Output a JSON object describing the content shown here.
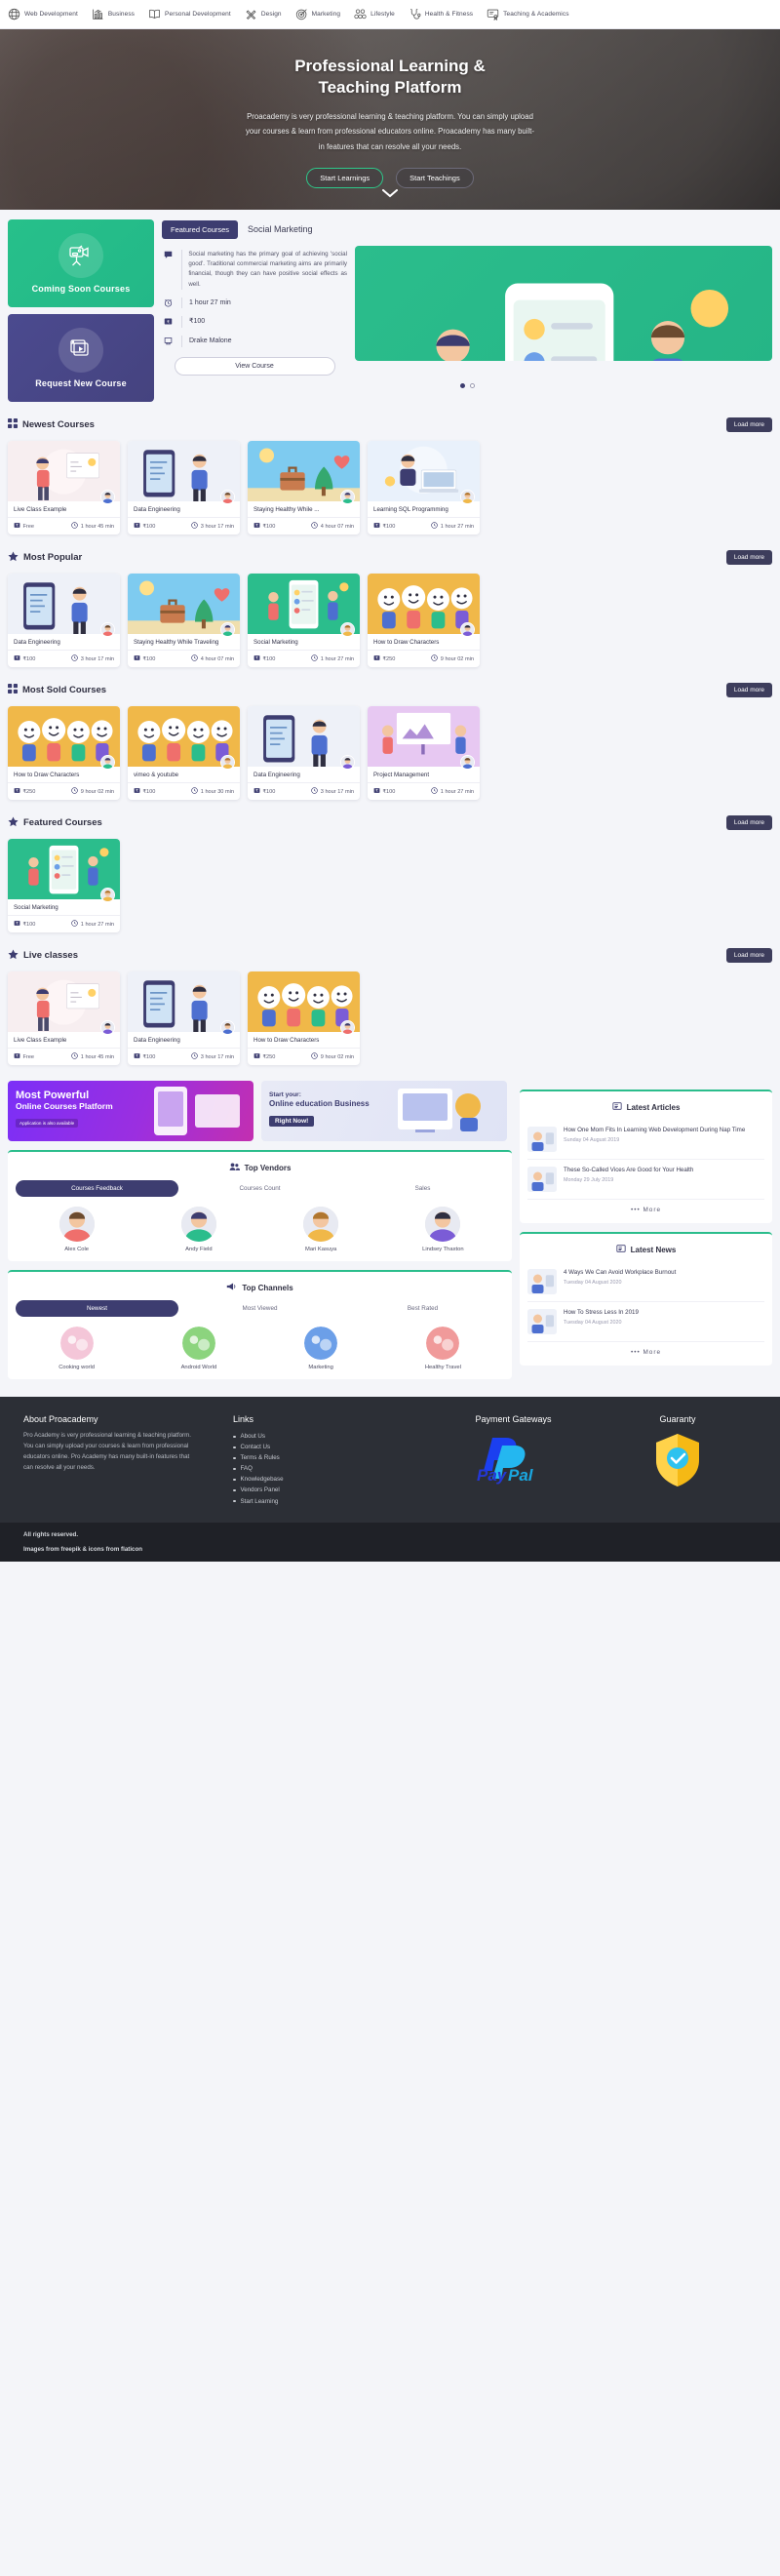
{
  "topbar": {
    "categories": [
      {
        "icon": "globe-icon",
        "label": "Web Development"
      },
      {
        "icon": "bar-chart-icon",
        "label": "Business"
      },
      {
        "icon": "book-icon",
        "label": "Personal Development"
      },
      {
        "icon": "pencil-ruler-icon",
        "label": "Design"
      },
      {
        "icon": "target-icon",
        "label": "Marketing"
      },
      {
        "icon": "group-icon",
        "label": "Lifestyle"
      },
      {
        "icon": "stethoscope-icon",
        "label": "Health & Fitness"
      },
      {
        "icon": "certificate-icon",
        "label": "Teaching & Academics"
      }
    ]
  },
  "hero": {
    "title_line1": "Professional Learning &",
    "title_line2": "Teaching Platform",
    "paragraph": "Proacademy is very professional learning & teaching platform. You can simply upload your courses & learn from professional educators online. Proacademy has many built-in features that can resolve all your needs.",
    "primary_button": "Start Learnings",
    "secondary_button": "Start Teachings",
    "scroll_icon": "chevron-down-icon"
  },
  "promos": [
    {
      "title": "Coming Soon Courses",
      "icon": "video-camera-icon",
      "color": "#27c08a"
    },
    {
      "title": "Request New Course",
      "icon": "play-stack-icon",
      "color": "#4b4a8f"
    }
  ],
  "featured": {
    "tab_active": "Featured Courses",
    "tab_title": "Social Marketing",
    "description": "Social marketing has the primary goal of achieving 'social good'. Traditional commercial marketing aims are primarily financial, though they can have positive social effects as well.",
    "duration": "1 hour 27 min",
    "price": "₹100",
    "instructor": "Drake Malone",
    "view_button": "View Course",
    "slide_dots": 2,
    "active_dot": 0
  },
  "sections": [
    {
      "icon": "grid-icon",
      "title": "Newest Courses",
      "load_more": "Load more",
      "courses": [
        {
          "name": "Live Class Example",
          "price": "Free",
          "duration": "1 hour 45 min",
          "thumb": "woman-board",
          "color": "#f6e3e6"
        },
        {
          "name": "Data Engineering",
          "price": "₹100",
          "duration": "3 hour 17 min",
          "thumb": "dev-screen",
          "color": "#e9edf6"
        },
        {
          "name": "Staying Healthy While ...",
          "price": "₹100",
          "duration": "4 hour 07 min",
          "thumb": "travel-health",
          "color": "#7ecbf0"
        },
        {
          "name": "Learning SQL Programming",
          "price": "₹100",
          "duration": "1 hour 27 min",
          "thumb": "laptop-woman",
          "color": "#e7effb"
        }
      ]
    },
    {
      "icon": "star-icon",
      "title": "Most Popular",
      "load_more": "Load more",
      "courses": [
        {
          "name": "Data Engineering",
          "price": "₹100",
          "duration": "3 hour 17 min",
          "thumb": "dev-screen",
          "color": "#eef1f8"
        },
        {
          "name": "Staying Healthy While Traveling",
          "price": "₹100",
          "duration": "4 hour 07 min",
          "thumb": "travel-health",
          "color": "#7ecbf0"
        },
        {
          "name": "Social Marketing",
          "price": "₹100",
          "duration": "1 hour 27 min",
          "thumb": "social-chat",
          "color": "#2bbd8c"
        },
        {
          "name": "How to Draw Characters",
          "price": "₹250",
          "duration": "9 hour 02 min",
          "thumb": "faces",
          "color": "#f0b849"
        }
      ]
    },
    {
      "icon": "grid-icon",
      "title": "Most Sold Courses",
      "load_more": "Load more",
      "courses": [
        {
          "name": "How to Draw Characters",
          "price": "₹250",
          "duration": "9 hour 02 min",
          "thumb": "faces",
          "color": "#f0b849"
        },
        {
          "name": "vimeo & youtube",
          "price": "₹100",
          "duration": "1 hour 30 min",
          "thumb": "faces",
          "color": "#f0b849"
        },
        {
          "name": "Data Engineering",
          "price": "₹100",
          "duration": "3 hour 17 min",
          "thumb": "dev-screen",
          "color": "#eef1f8"
        },
        {
          "name": "Project Management",
          "price": "₹100",
          "duration": "1 hour 27 min",
          "thumb": "presentation",
          "color": "#e7c8f2"
        }
      ]
    },
    {
      "icon": "star-icon",
      "title": "Featured Courses",
      "load_more": "Load more",
      "courses": [
        {
          "name": "Social Marketing",
          "price": "₹100",
          "duration": "1 hour 27 min",
          "thumb": "social-chat",
          "color": "#2bbd8c"
        }
      ]
    },
    {
      "icon": "star-icon",
      "title": "Live classes",
      "load_more": "Load more",
      "courses": [
        {
          "name": "Live Class Example",
          "price": "Free",
          "duration": "1 hour 45 min",
          "thumb": "woman-board",
          "color": "#f6e3e6"
        },
        {
          "name": "Data Engineering",
          "price": "₹100",
          "duration": "3 hour 17 min",
          "thumb": "dev-screen",
          "color": "#eef1f8"
        },
        {
          "name": "How to Draw Characters",
          "price": "₹250",
          "duration": "9 hour 02 min",
          "thumb": "faces",
          "color": "#f0b849"
        }
      ]
    }
  ],
  "banners": [
    {
      "line1": "Most Powerful",
      "line2": "Online Courses Platform",
      "line3": "Application is also available"
    },
    {
      "line1": "Start your:",
      "line2": "Online education Business",
      "cta": "Right Now!"
    }
  ],
  "top_vendors": {
    "title": "Top Vendors",
    "icon": "people-icon",
    "tabs": [
      "Courses Feedback",
      "Courses Count",
      "Sales"
    ],
    "active_tab": 0,
    "vendors": [
      {
        "name": "Alex Cole"
      },
      {
        "name": "Andy Field"
      },
      {
        "name": "Mari Kasuya"
      },
      {
        "name": "Lindsey Thaxton"
      }
    ]
  },
  "top_channels": {
    "title": "Top Channels",
    "icon": "megaphone-icon",
    "tabs": [
      "Newest",
      "Most Viewed",
      "Best Rated"
    ],
    "active_tab": 0,
    "channels": [
      {
        "name": "Cooking world"
      },
      {
        "name": "Android World"
      },
      {
        "name": "Marketing"
      },
      {
        "name": "Healthy Travel"
      }
    ]
  },
  "latest_articles": {
    "title": "Latest Articles",
    "icon": "news-icon",
    "items": [
      {
        "title": "How One Mom Fits In Learning Web Development During Nap Time",
        "date": "Sunday 04 August 2019"
      },
      {
        "title": "These So-Called Vices Are Good for Your Health",
        "date": "Monday 29 July 2019"
      }
    ],
    "more": "••• More"
  },
  "latest_news": {
    "title": "Latest News",
    "icon": "news-icon",
    "items": [
      {
        "title": "4 Ways We Can Avoid Workplace Burnout",
        "date": "Tuesday 04 August 2020"
      },
      {
        "title": "How To Stress Less In 2019",
        "date": "Tuesday 04 August 2020"
      }
    ],
    "more": "••• More"
  },
  "footer": {
    "about_title": "About Proacademy",
    "about_text": "Pro Academy is very professional learning & teaching platform. You can simply upload your courses & learn from professional educators online. Pro Academy has many built-in features that can resolve all your needs.",
    "links_title": "Links",
    "links": [
      "About Us",
      "Contact Us",
      "Terms & Rules",
      "FAQ",
      "Knowledgebase",
      "Vendors Panel",
      "Start Learning"
    ],
    "payment_title": "Payment Gateways",
    "payment_logo": "PayPal",
    "guaranty_title": "Guaranty",
    "guaranty_icon": "check-badge-icon",
    "bottom_line1": "All rights reserved.",
    "bottom_line2": "Images from freepik & icons from flaticon"
  }
}
